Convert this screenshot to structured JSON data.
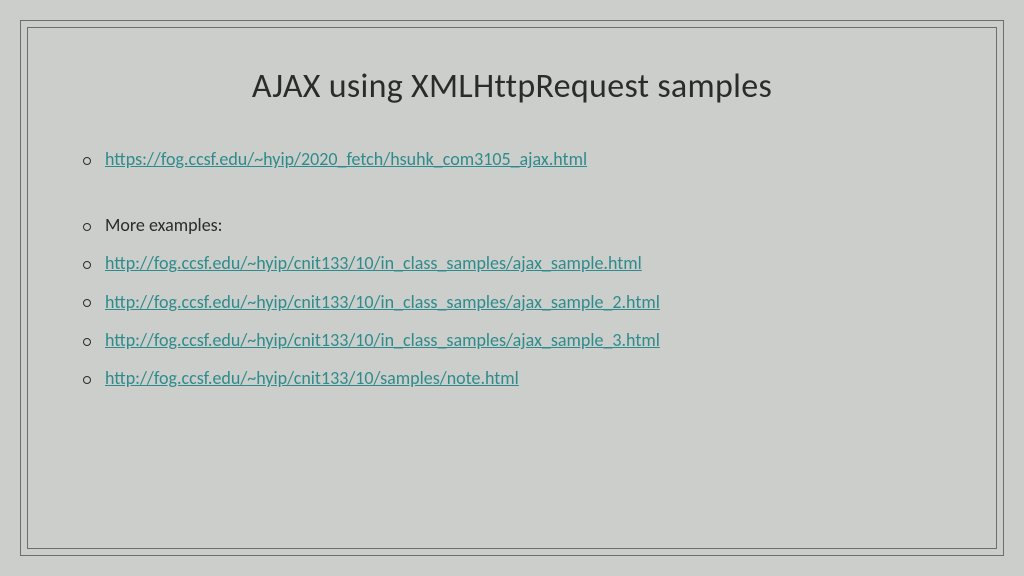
{
  "title": "AJAX using XMLHttpRequest samples",
  "items": [
    {
      "text": "https://fog.ccsf.edu/~hyip/2020_fetch/hsuhk_com3105_ajax.html",
      "type": "link"
    },
    {
      "type": "spacer"
    },
    {
      "text": "More examples:",
      "type": "plain"
    },
    {
      "text": "http://fog.ccsf.edu/~hyip/cnit133/10/in_class_samples/ajax_sample.html",
      "type": "link"
    },
    {
      "text": "http://fog.ccsf.edu/~hyip/cnit133/10/in_class_samples/ajax_sample_2.html",
      "type": "link"
    },
    {
      "text": "http://fog.ccsf.edu/~hyip/cnit133/10/in_class_samples/ajax_sample_3.html",
      "type": "link"
    },
    {
      "text": "http://fog.ccsf.edu/~hyip/cnit133/10/samples/note.html",
      "type": "link"
    }
  ]
}
